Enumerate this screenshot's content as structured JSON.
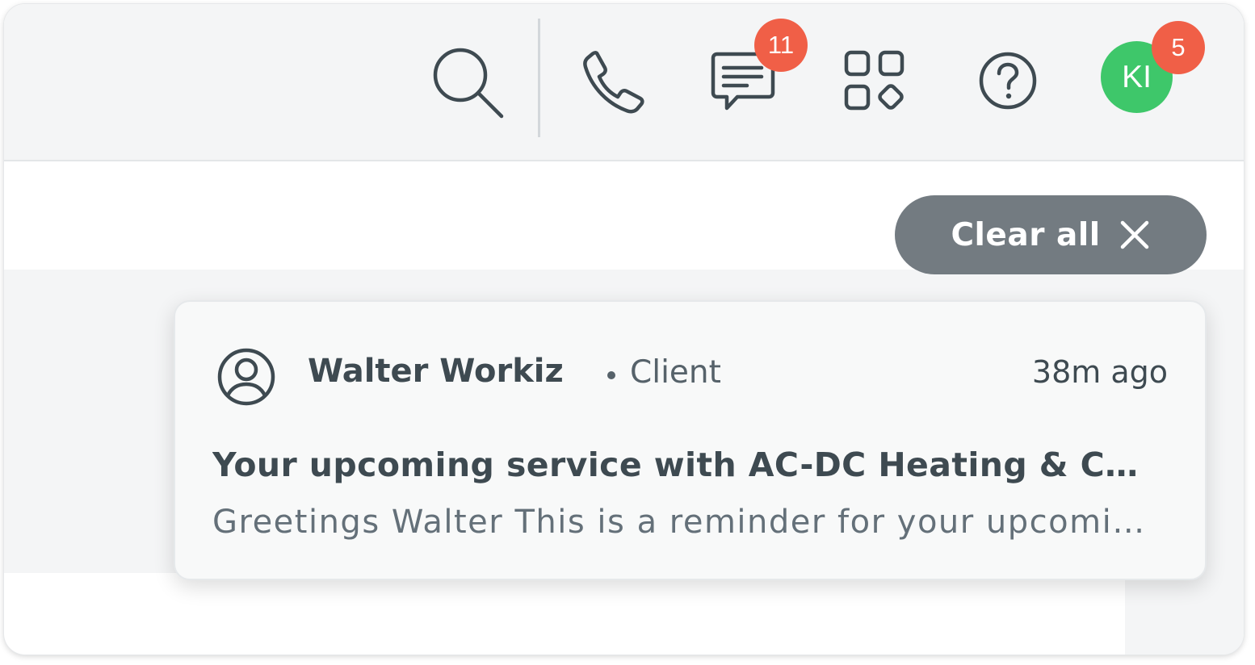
{
  "topbar": {
    "messages_badge": "11",
    "avatar_initials": "KI",
    "avatar_badge": "5",
    "icons": [
      "search-icon",
      "phone-icon",
      "chat-icon",
      "apps-icon",
      "help-icon"
    ]
  },
  "notifications": {
    "clear_all_label": "Clear all",
    "items": [
      {
        "sender": "Walter Workiz",
        "role": "Client",
        "time": "38m ago",
        "title": "Your upcoming service with AC-DC Heating & Cooling",
        "preview": "Greetings Walter This is a reminder for your upcoming service appointment"
      }
    ]
  },
  "colors": {
    "badge": "#f05f47",
    "avatar": "#3ec76a",
    "clear_all_bg": "#737b81",
    "icon_stroke": "#3e4a51"
  }
}
